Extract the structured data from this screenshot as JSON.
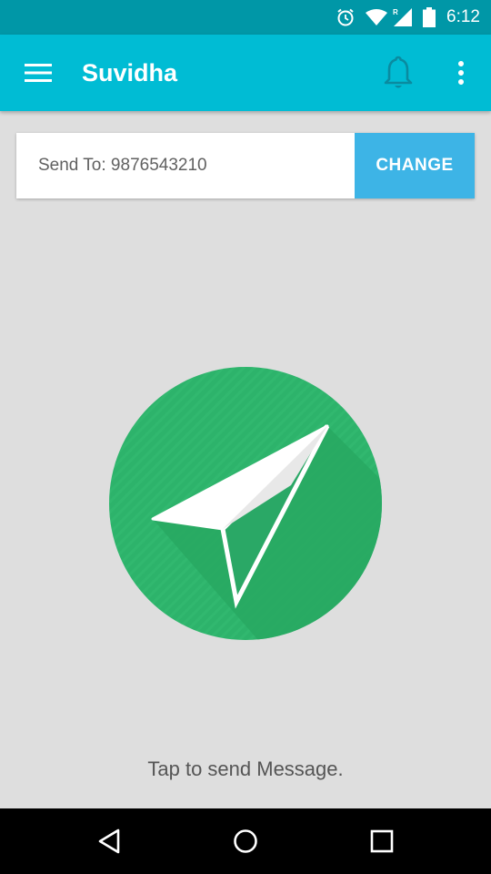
{
  "status_bar": {
    "time": "6:12",
    "icons": [
      "alarm-icon",
      "wifi-icon",
      "signal-roaming-icon",
      "battery-icon"
    ]
  },
  "app_bar": {
    "title": "Suvidha",
    "menu_icon": "hamburger-menu-icon",
    "notification_icon": "bell-icon",
    "overflow_icon": "more-vert-icon"
  },
  "send_card": {
    "recipient_text": "Send To: 9876543210",
    "change_label": "CHANGE"
  },
  "send_button": {
    "icon": "paper-plane-icon"
  },
  "footer": {
    "hint": "Tap to send Message."
  },
  "nav_bar": {
    "icons": [
      "back-icon",
      "home-icon",
      "recents-icon"
    ]
  },
  "colors": {
    "status_bar": "#0097a7",
    "app_bar": "#00bcd4",
    "change_button": "#3db4e6",
    "send_circle": "#2db36b",
    "background": "#dedede"
  }
}
